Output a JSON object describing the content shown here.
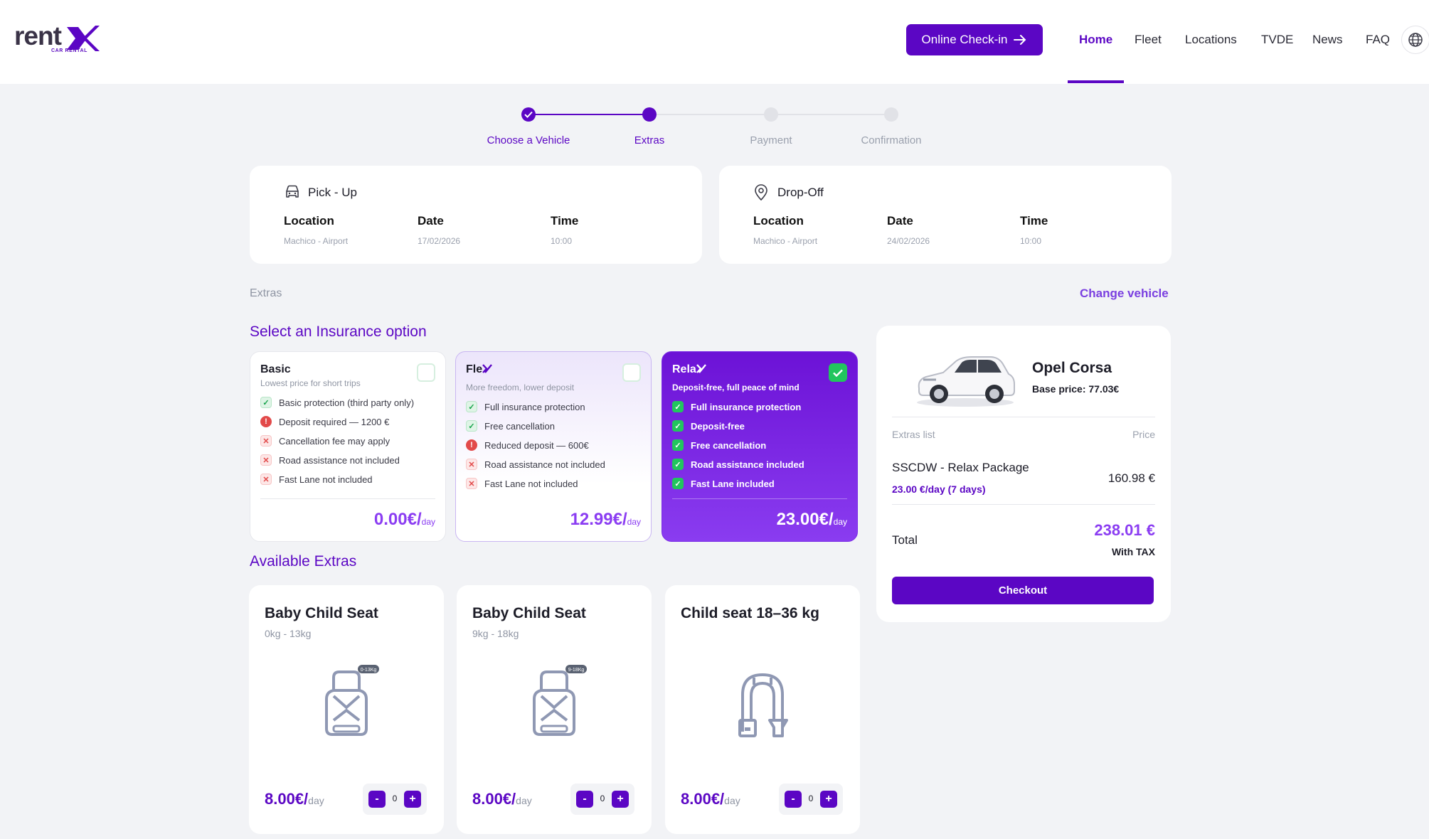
{
  "brand": {
    "logo_text": "rent",
    "logo_sub": "CAR RENTAL",
    "accent": "#5b06c4",
    "accent_light": "#8b3df2"
  },
  "header": {
    "checkin_label": "Online Check-in",
    "nav": [
      "Home",
      "Fleet",
      "Locations",
      "TVDE",
      "News",
      "FAQ"
    ],
    "active_nav": "Home"
  },
  "steps": [
    {
      "label": "Choose a Vehicle",
      "state": "done"
    },
    {
      "label": "Extras",
      "state": "current"
    },
    {
      "label": "Payment",
      "state": "pending"
    },
    {
      "label": "Confirmation",
      "state": "pending"
    }
  ],
  "pickup": {
    "title": "Pick - Up",
    "location_label": "Location",
    "location": "Machico - Airport",
    "date_label": "Date",
    "date": "17/02/2026",
    "time_label": "Time",
    "time": "10:00"
  },
  "dropoff": {
    "title": "Drop-Off",
    "location_label": "Location",
    "location": "Machico - Airport",
    "date_label": "Date",
    "date": "24/02/2026",
    "time_label": "Time",
    "time": "10:00"
  },
  "breadcrumb": "Extras",
  "change_vehicle": "Change vehicle",
  "insurance_title": "Select an Insurance option",
  "insurance": [
    {
      "name": "Basic",
      "subtitle": "Lowest price for short trips",
      "selected": false,
      "features": [
        {
          "text": "Basic protection (third party only)",
          "kind": "ok"
        },
        {
          "text": "Deposit required — 1200 €",
          "kind": "warn"
        },
        {
          "text": "Cancellation fee may apply",
          "kind": "x"
        },
        {
          "text": "Road assistance not included",
          "kind": "x"
        },
        {
          "text": "Fast Lane not included",
          "kind": "x"
        }
      ],
      "price": "0.00€/",
      "unit": "day"
    },
    {
      "name": "Fle",
      "subtitle": "More freedom, lower deposit",
      "selected": false,
      "features": [
        {
          "text": "Full insurance protection",
          "kind": "ok"
        },
        {
          "text": "Free cancellation",
          "kind": "ok"
        },
        {
          "text": "Reduced deposit — 600€",
          "kind": "warn"
        },
        {
          "text": "Road assistance not included",
          "kind": "x"
        },
        {
          "text": "Fast Lane not included",
          "kind": "x"
        }
      ],
      "price": "12.99€/",
      "unit": "day"
    },
    {
      "name": "Rela",
      "subtitle": "Deposit-free, full peace of mind",
      "selected": true,
      "features": [
        {
          "text": "Full insurance protection",
          "kind": "ok"
        },
        {
          "text": "Deposit-free",
          "kind": "ok"
        },
        {
          "text": "Free cancellation",
          "kind": "ok"
        },
        {
          "text": "Road assistance included",
          "kind": "ok"
        },
        {
          "text": "Fast Lane included",
          "kind": "ok"
        }
      ],
      "price": "23.00€/",
      "unit": "day"
    }
  ],
  "extras_title": "Available Extras",
  "extras": [
    {
      "title": "Baby Child Seat",
      "subtitle": "0kg - 13kg",
      "badge": "0-13Kg",
      "icon": "child-seat-icon",
      "price": "8.00€/",
      "unit": "day",
      "qty": "0"
    },
    {
      "title": "Baby Child Seat",
      "subtitle": "9kg - 18kg",
      "badge": "9-18Kg",
      "icon": "child-seat-icon",
      "price": "8.00€/",
      "unit": "day",
      "qty": "0"
    },
    {
      "title": "Child seat 18–36 kg",
      "subtitle": "",
      "badge": "",
      "icon": "booster-seat-icon",
      "price": "8.00€/",
      "unit": "day",
      "qty": "0"
    }
  ],
  "summary": {
    "car_name": "Opel Corsa",
    "base_price": "Base price: 77.03€",
    "extras_list_label": "Extras list",
    "price_label": "Price",
    "item_name": "SSCDW - Relax Package",
    "item_detail": "23.00 €/day (7 days)",
    "item_price": "160.98 €",
    "total_label": "Total",
    "total": "238.01 €",
    "tax_note": "With TAX",
    "checkout": "Checkout"
  },
  "stepper_minus": "-",
  "stepper_plus": "+"
}
